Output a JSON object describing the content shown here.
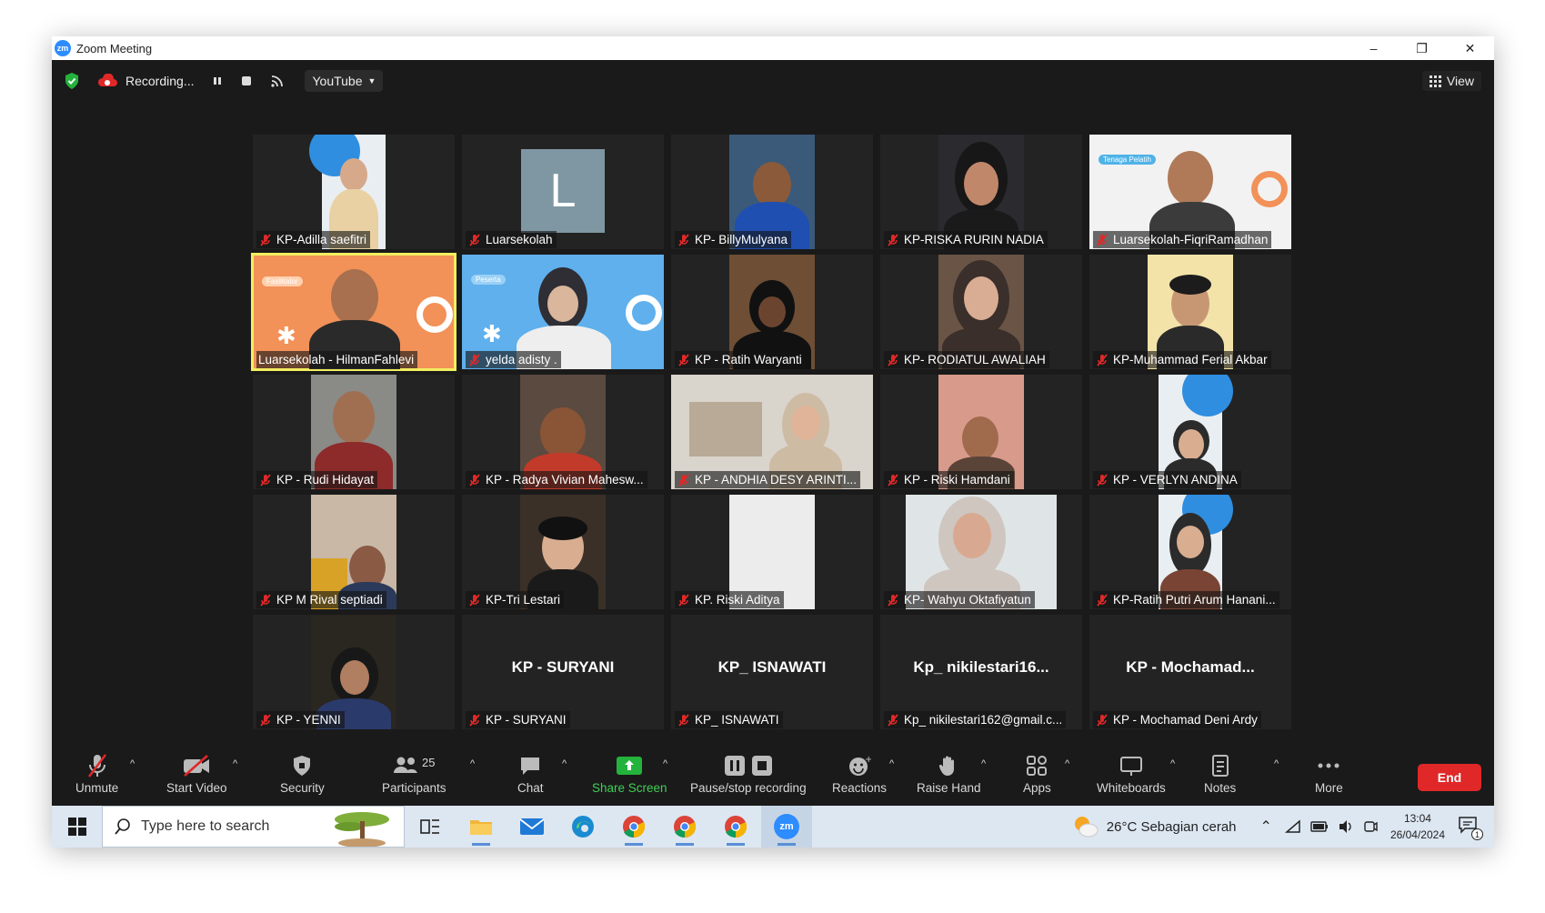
{
  "window": {
    "title": "Zoom Meeting"
  },
  "topbar": {
    "recording_label": "Recording...",
    "stream_label": "YouTube",
    "view_label": "View",
    "colors": {
      "shield": "#23b33c",
      "recording_cloud": "#e02828"
    }
  },
  "participants": [
    {
      "name": "KP-Adilla saefitri",
      "video": true
    },
    {
      "name": "Luarsekolah",
      "video": false,
      "initial": "L"
    },
    {
      "name": "KP- BillyMulyana",
      "video": true
    },
    {
      "name": "KP-RISKA RURIN NADIA",
      "video": true
    },
    {
      "name": "Luarsekolah-FiqriRamadhan",
      "video": true,
      "bg_text": "Tenaga Pelatih"
    },
    {
      "name": "Luarsekolah - HilmanFahlevi",
      "video": true,
      "active_speaker": true,
      "bg_text": "Fasilitator",
      "mic_on": true
    },
    {
      "name": "yelda adisty .",
      "video": true,
      "bg_text": "Peserta"
    },
    {
      "name": "KP - Ratih Waryanti",
      "video": true
    },
    {
      "name": "KP- RODIATUL AWALIAH",
      "video": true
    },
    {
      "name": "KP-Muhammad Ferial Akbar",
      "video": true
    },
    {
      "name": "KP - Rudi Hidayat",
      "video": true
    },
    {
      "name": "KP - Radya Vivian Mahesw...",
      "video": true
    },
    {
      "name": "KP - ANDHIA DESY ARINTI...",
      "video": true
    },
    {
      "name": "KP - Riski Hamdani",
      "video": true
    },
    {
      "name": "KP - VERLYN ANDINA",
      "video": true
    },
    {
      "name": "KP M Rival septiadi",
      "video": true
    },
    {
      "name": "KP-Tri Lestari",
      "video": true
    },
    {
      "name": "KP. Riski Aditya",
      "video": true
    },
    {
      "name": "KP- Wahyu Oktafiyatun",
      "video": true
    },
    {
      "name": "KP-Ratih Putri Arum Hanani...",
      "video": true
    },
    {
      "name": "KP - YENNI",
      "video": true
    },
    {
      "name": "KP - SURYANI",
      "video": false,
      "display": "KP - SURYANI"
    },
    {
      "name": "KP_ ISNAWATI",
      "video": false,
      "display": "KP_ ISNAWATI"
    },
    {
      "name": "Kp_ nikilestari162@gmail.c...",
      "video": false,
      "display": "Kp_ nikilestari16..."
    },
    {
      "name": "KP - Mochamad Deni Ardy",
      "video": false,
      "display": "KP - Mochamad..."
    }
  ],
  "toolbar": {
    "unmute": "Unmute",
    "start_video": "Start Video",
    "security": "Security",
    "participants": "Participants",
    "participants_count": "25",
    "chat": "Chat",
    "share_screen": "Share Screen",
    "pause_stop": "Pause/stop recording",
    "reactions": "Reactions",
    "raise_hand": "Raise Hand",
    "apps": "Apps",
    "whiteboards": "Whiteboards",
    "notes": "Notes",
    "more": "More",
    "end": "End",
    "colors": {
      "share": "#23b33c",
      "end": "#e02828"
    }
  },
  "taskbar": {
    "search_placeholder": "Type here to search",
    "weather": "26°C  Sebagian cerah",
    "time": "13:04",
    "date": "26/04/2024",
    "notification_count": "1",
    "apps": [
      "task-view-icon",
      "file-explorer-icon",
      "mail-icon",
      "edge-icon",
      "chrome-icon",
      "chrome-icon",
      "chrome-icon",
      "zoom-icon"
    ]
  }
}
